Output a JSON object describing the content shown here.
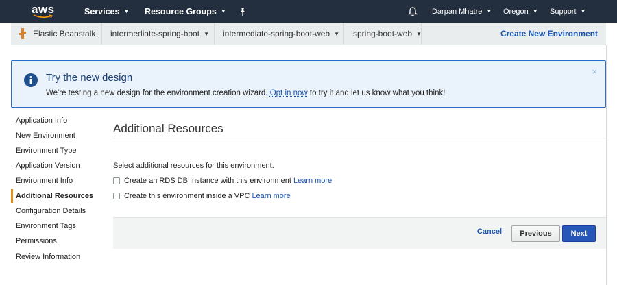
{
  "topnav": {
    "logo": "aws",
    "services": "Services",
    "resource_groups": "Resource Groups",
    "user": "Darpan Mhatre",
    "region": "Oregon",
    "support": "Support"
  },
  "breadcrumb": {
    "service": "Elastic Beanstalk",
    "application": "intermediate-spring-boot",
    "environment": "intermediate-spring-boot-web",
    "environment2": "spring-boot-web",
    "create_link": "Create New Environment"
  },
  "banner": {
    "title": "Try the new design",
    "text_before": "We're testing a new design for the environment creation wizard. ",
    "link": "Opt in now",
    "text_after": " to try it and let us know what you think!",
    "close": "×"
  },
  "sidebar": {
    "items": [
      {
        "label": "Application Info"
      },
      {
        "label": "New Environment"
      },
      {
        "label": "Environment Type"
      },
      {
        "label": "Application Version"
      },
      {
        "label": "Environment Info"
      },
      {
        "label": "Additional Resources"
      },
      {
        "label": "Configuration Details"
      },
      {
        "label": "Environment Tags"
      },
      {
        "label": "Permissions"
      },
      {
        "label": "Review Information"
      }
    ],
    "active": "Additional Resources"
  },
  "main": {
    "title": "Additional Resources",
    "description": "Select additional resources for this environment.",
    "options": [
      {
        "label": "Create an RDS DB Instance with this environment",
        "link": "Learn more",
        "checked": false
      },
      {
        "label": "Create this environment inside a VPC",
        "link": "Learn more",
        "checked": false
      }
    ]
  },
  "actions": {
    "cancel": "Cancel",
    "previous": "Previous",
    "next": "Next"
  },
  "colors": {
    "nav_bg": "#232f3e",
    "accent_blue": "#2656b7",
    "active_marker": "#e98d0f",
    "banner_bg": "#eaf3fb"
  }
}
